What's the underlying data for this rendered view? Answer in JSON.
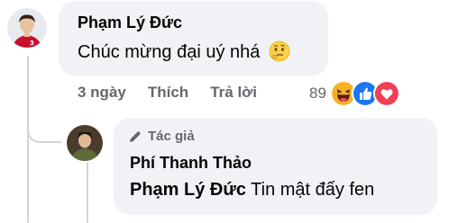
{
  "comment": {
    "author": "Phạm Lý Đức",
    "text": "Chúc mừng đại uý nhá",
    "emoji": "thinking-face-emoji",
    "time": "3 ngày",
    "like_label": "Thích",
    "reply_label": "Trả lời",
    "reaction_count": "89",
    "reactions": [
      "haha",
      "like",
      "love"
    ]
  },
  "reply": {
    "badge": "Tác giả",
    "author": "Phí Thanh Thảo",
    "mention": "Phạm Lý Đức",
    "text": " Tin mật đấy fen"
  },
  "colors": {
    "bubble": "#f0f2f5",
    "secondary_text": "#65676b",
    "like_blue": "#1877f2",
    "love_red": "#f33e58",
    "haha_yellow": "#f7b125"
  }
}
